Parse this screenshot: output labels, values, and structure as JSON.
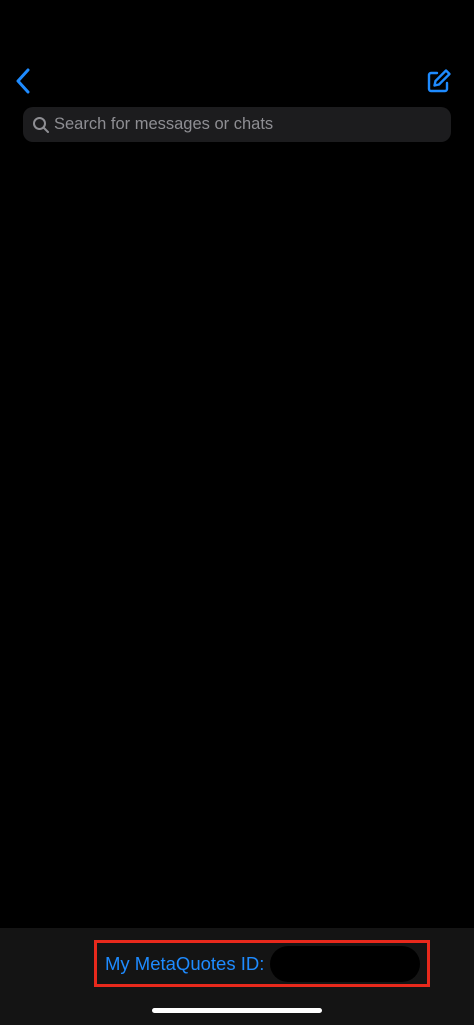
{
  "nav": {
    "back_icon": "chevron-left-icon",
    "compose_icon": "compose-icon",
    "accent_color": "#1e8bff"
  },
  "search": {
    "placeholder": "Search for messages or chats",
    "value": "",
    "icon": "search-icon"
  },
  "footer": {
    "id_label": "My MetaQuotes ID:",
    "id_value": "",
    "highlight_color": "#e8291c"
  }
}
